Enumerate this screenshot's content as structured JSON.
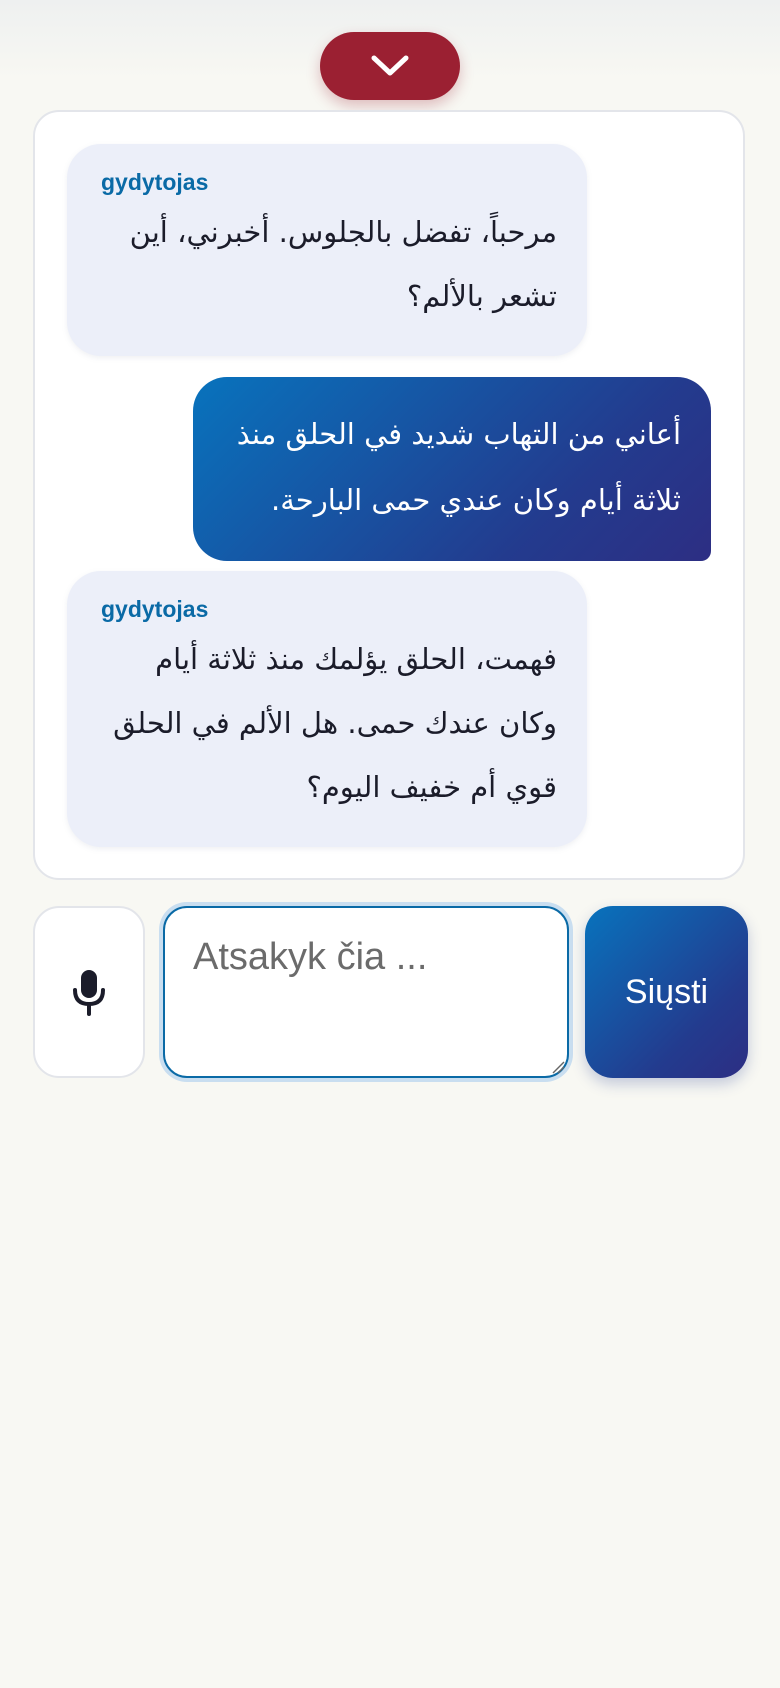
{
  "header": {
    "collapse_icon": "chevron-down-icon"
  },
  "messages": [
    {
      "role": "doctor",
      "sender": "gydytojas",
      "text": "مرحباً، تفضل بالجلوس. أخبرني، أين تشعر بالألم؟"
    },
    {
      "role": "patient",
      "sender": "",
      "text": "أعاني من التهاب شديد في الحلق منذ ثلاثة أيام وكان عندي حمى البارحة."
    },
    {
      "role": "doctor",
      "sender": "gydytojas",
      "text": "فهمت، الحلق يؤلمك منذ ثلاثة أيام وكان عندك حمى. هل الألم في الحلق قوي أم خفيف اليوم؟"
    }
  ],
  "composer": {
    "mic_icon": "microphone-icon",
    "input_value": "",
    "input_placeholder": "Atsakyk čia ...",
    "send_label": "Siųsti"
  },
  "colors": {
    "collapse_button": "#9b2032",
    "accent_start": "#0873bd",
    "accent_end": "#2d2e83",
    "doctor_bubble": "#eceff9",
    "sender_label": "#0a6aa6",
    "page_background": "#f8f8f3"
  }
}
